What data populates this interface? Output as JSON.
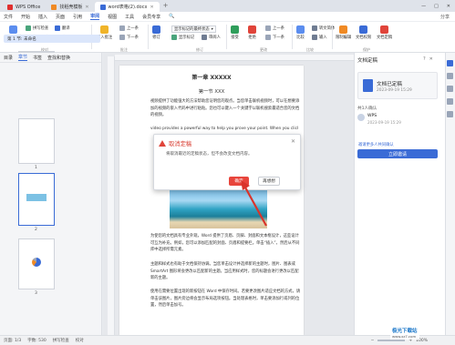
{
  "tabs": [
    {
      "label": "WPS Office"
    },
    {
      "label": "找稻壳模板"
    },
    {
      "label": "word表格(2).docx"
    }
  ],
  "window": {
    "close": "✕",
    "minimize": "—",
    "maximize": "□"
  },
  "menu": {
    "file": "文件",
    "items": [
      "开始",
      "插入",
      "页面",
      "引用",
      "审阅",
      "视图",
      "工具",
      "会员专享"
    ],
    "active": "审阅",
    "search": "🔍",
    "share": "分享"
  },
  "ribbon": {
    "buttons": [
      "文档校对",
      "拼写检查",
      "翻译",
      "字数统计",
      "插入批注",
      "上一条",
      "下一条",
      "修订",
      "显示标记的最终状态",
      "显示标记",
      "审阅人",
      "接受",
      "拒绝",
      "上一条",
      "下一条",
      "比较",
      "限制编辑",
      "文档权限",
      "文档定稿"
    ],
    "small": [
      "中文简繁",
      "批注",
      "删除",
      "显示",
      "转文简体",
      "输入"
    ],
    "groups": [
      "校对",
      "批注",
      "修订",
      "更改",
      "比较",
      "保护"
    ]
  },
  "leftpanel": {
    "tabs": [
      "目录",
      "章节",
      "书签",
      "查找和替换"
    ],
    "active": "章节",
    "outline": "第 1 节: 未命名",
    "page_numbers": [
      "1",
      "2",
      "3"
    ]
  },
  "document": {
    "chapter": "第一章 XXXXX",
    "section": "第一节 XXX",
    "paragraphs": [
      "视频提供了功能强大的方法帮助您证明您的观点。当您单击联机视频时，可以在想要添加的视频的嵌入代码中进行粘贴。您也可以键入一个关键字以联机搜索最适合您的文档的视频。",
      "video provides a powerful way to help you prove your point. When you click the",
      "为使您的文档具有专业外观，Word 提供了页眉、页脚、封面和文本框设计，这些设计可互为补充。例如，您可以添加匹配的封面、页眉和提要栏。单击“插入”，然后从不同库中选择所需元素。",
      "主题和样式也有助于文档保持协调。当您单击设计并选择新的主题时，图片、图表或 SmartArt 图形将会更改以匹配新的主题。当应用样式时，您的标题会进行更改以匹配新的主题。",
      "使用在需要位置出现的新按钮在 Word 中保存时间。若要更改图片适应文档的方式，请单击该图片，图片旁边将会显示布局选项按钮。当处理表格时，单击要添加行或列的位置，然后单击加号。"
    ]
  },
  "dialog": {
    "title": "取消定稿",
    "message": "将取消最近的定稿状态，但不会改变文档内容。",
    "ok": "确定",
    "cancel": "再想想",
    "close": "✕"
  },
  "rightpanel": {
    "title": "文档定稿",
    "card_name": "文档已定稿",
    "card_date": "2023-09-19 15:29",
    "sub_title": "共1人确认",
    "user": "WPS",
    "user_date": "2023-09-19 15:29",
    "link": "邀请更多人共同确认",
    "button": "立即邀请"
  },
  "status": {
    "page": "页面: 1/3",
    "words": "字数: 530",
    "spell": "拼写检查",
    "proof": "校对",
    "zoom": "100%"
  },
  "watermark": {
    "line1": "极光下载站",
    "line2": "www.xz7.com"
  },
  "colors": {
    "accent": "#3a6bd6",
    "danger": "#e8453c"
  }
}
